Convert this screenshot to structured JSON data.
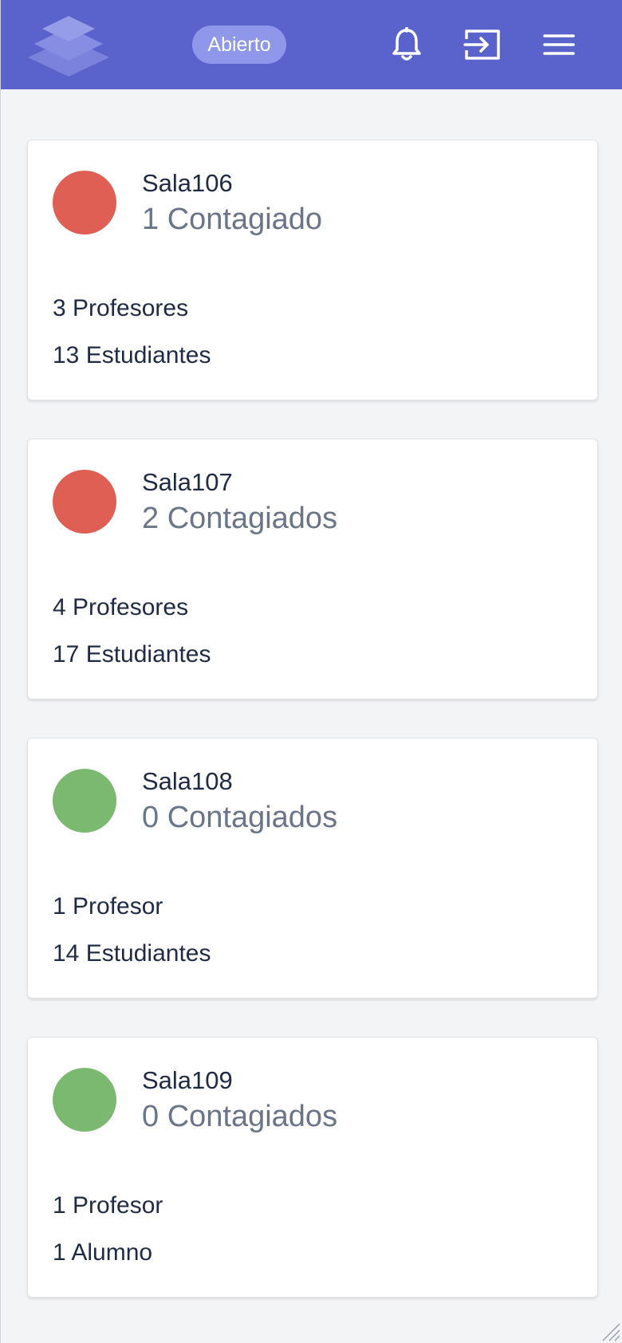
{
  "header": {
    "background": "#5a63cc",
    "status_label": "Abierto",
    "icons": [
      "layers-logo-icon",
      "bell-icon",
      "login-icon",
      "menu-icon"
    ]
  },
  "status_colors": {
    "infected": "#e05f55",
    "clear": "#7cb970"
  },
  "rooms": [
    {
      "name": "Sala106",
      "infected": "1 Contagiado",
      "teachers": "3 Profesores",
      "students": "13 Estudiantes",
      "status": "infected"
    },
    {
      "name": "Sala107",
      "infected": "2 Contagiados",
      "teachers": "4 Profesores",
      "students": "17 Estudiantes",
      "status": "infected"
    },
    {
      "name": "Sala108",
      "infected": "0 Contagiados",
      "teachers": "1 Profesor",
      "students": "14 Estudiantes",
      "status": "clear"
    },
    {
      "name": "Sala109",
      "infected": "0 Contagiados",
      "teachers": "1 Profesor",
      "students": "1 Alumno",
      "status": "clear"
    }
  ]
}
